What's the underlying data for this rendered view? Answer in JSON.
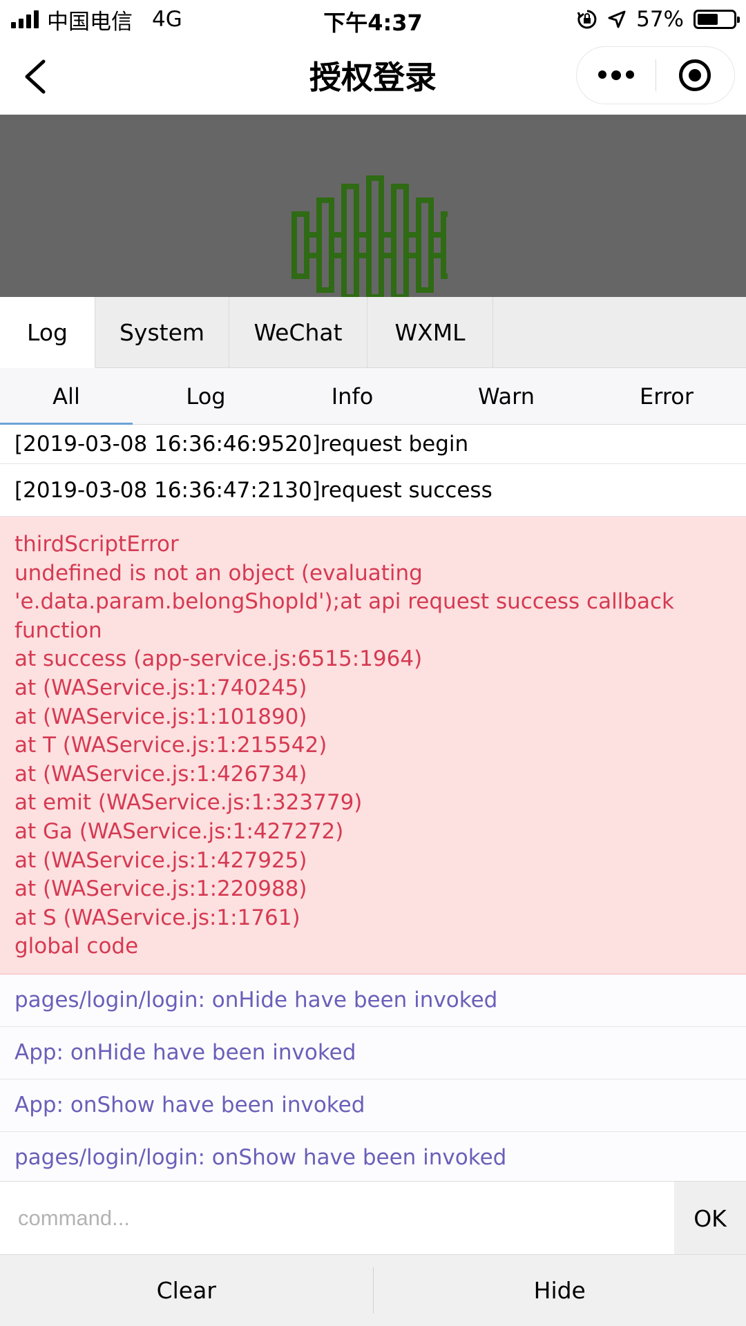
{
  "status_bar": {
    "carrier": "中国电信",
    "network": "4G",
    "time": "下午4:37",
    "battery_percent": "57%",
    "battery_level": 0.57,
    "icons": [
      "signal-icon",
      "rotation-lock-icon",
      "location-arrow-icon",
      "battery-icon"
    ]
  },
  "nav": {
    "title": "授权登录",
    "icons": [
      "back-arrow-icon",
      "more-dots-icon",
      "target-icon"
    ]
  },
  "banner": {
    "background": "#666666",
    "logo_color": "#2f6a14",
    "logo_icon": "green-logo-icon"
  },
  "tabs": [
    {
      "label": "Log",
      "active": true
    },
    {
      "label": "System",
      "active": false
    },
    {
      "label": "WeChat",
      "active": false
    },
    {
      "label": "WXML",
      "active": false
    }
  ],
  "subtabs": [
    {
      "label": "All",
      "active": true
    },
    {
      "label": "Log",
      "active": false
    },
    {
      "label": "Info",
      "active": false
    },
    {
      "label": "Warn",
      "active": false
    },
    {
      "label": "Error",
      "active": false
    }
  ],
  "logs": [
    {
      "type": "plain",
      "lines": [
        "[2019-03-08 16:36:46:9520]request begin"
      ]
    },
    {
      "type": "plain",
      "lines": [
        "[2019-03-08 16:36:47:2130]request success"
      ]
    },
    {
      "type": "error",
      "lines": [
        "thirdScriptError",
        "undefined is not an object (evaluating",
        "'e.data.param.belongShopId');at api request success callback",
        "function",
        "at success (app-service.js:6515:1964)",
        "at (WAService.js:1:740245)",
        "at (WAService.js:1:101890)",
        "at T (WAService.js:1:215542)",
        "at (WAService.js:1:426734)",
        "at emit (WAService.js:1:323779)",
        "at Ga (WAService.js:1:427272)",
        "at (WAService.js:1:427925)",
        "at (WAService.js:1:220988)",
        "at S (WAService.js:1:1761)",
        "global code"
      ]
    },
    {
      "type": "info",
      "lines": [
        "pages/login/login: onHide have been invoked"
      ]
    },
    {
      "type": "info",
      "lines": [
        "App: onHide have been invoked"
      ]
    },
    {
      "type": "info",
      "lines": [
        "App: onShow have been invoked"
      ]
    },
    {
      "type": "info",
      "lines": [
        "pages/login/login: onShow have been invoked"
      ]
    }
  ],
  "command": {
    "placeholder": "command...",
    "value": "",
    "ok_label": "OK"
  },
  "toolbar": {
    "clear_label": "Clear",
    "hide_label": "Hide"
  },
  "colors": {
    "error_text": "#d53a52",
    "error_bg": "#fde0e0",
    "info_text": "#6a5fb8",
    "active_underline": "#6ba3d6"
  }
}
